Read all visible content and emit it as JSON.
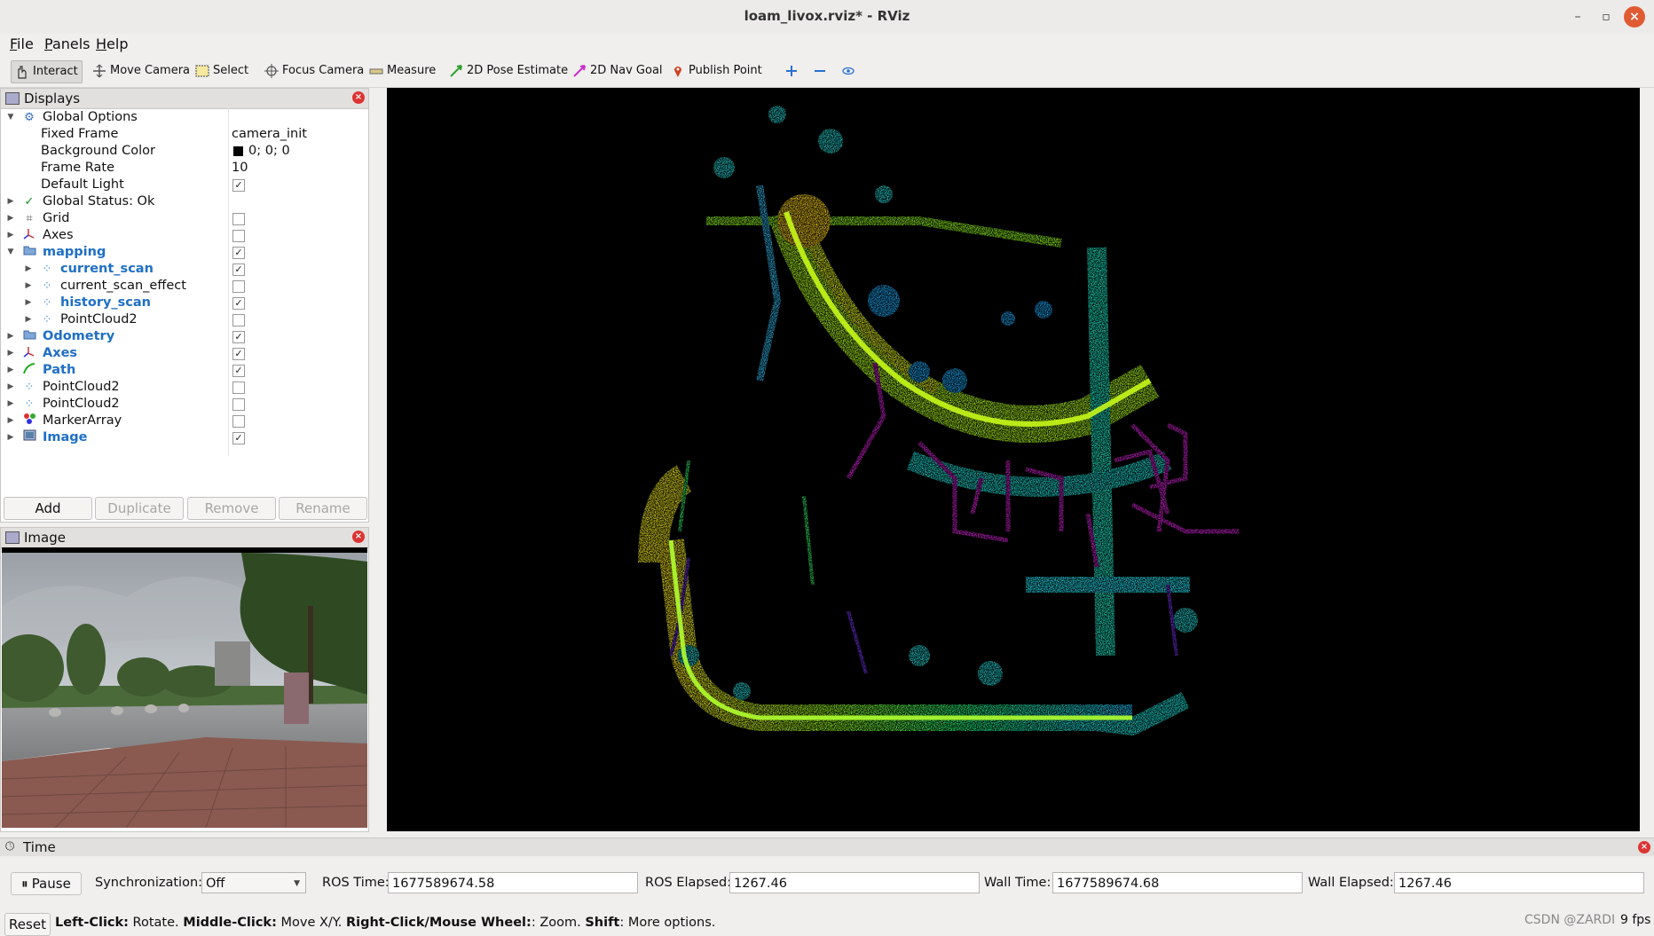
{
  "window": {
    "title": "loam_livox.rviz* - RViz"
  },
  "menu": {
    "file": "File",
    "panels": "Panels",
    "help": "Help"
  },
  "toolbar": {
    "interact": "Interact",
    "move_camera": "Move Camera",
    "select": "Select",
    "focus_camera": "Focus Camera",
    "measure": "Measure",
    "pose_estimate": "2D Pose Estimate",
    "nav_goal": "2D Nav Goal",
    "publish_point": "Publish Point"
  },
  "displays": {
    "title": "Displays",
    "global_options": "Global Options",
    "fixed_frame_label": "Fixed Frame",
    "fixed_frame_value": "camera_init",
    "background_color_label": "Background Color",
    "background_color_value": "0; 0; 0",
    "frame_rate_label": "Frame Rate",
    "frame_rate_value": "10",
    "default_light_label": "Default Light",
    "global_status": "Global Status: Ok",
    "items": [
      {
        "name": "Grid",
        "checked": false
      },
      {
        "name": "Axes",
        "checked": false
      },
      {
        "name": "mapping",
        "checked": true
      },
      {
        "name": "current_scan",
        "checked": true
      },
      {
        "name": "current_scan_effect",
        "checked": false
      },
      {
        "name": "history_scan",
        "checked": true
      },
      {
        "name": "PointCloud2",
        "checked": false
      },
      {
        "name": "Odometry",
        "checked": true
      },
      {
        "name": "Axes",
        "checked": true
      },
      {
        "name": "Path",
        "checked": true
      },
      {
        "name": "PointCloud2",
        "checked": false
      },
      {
        "name": "PointCloud2",
        "checked": false
      },
      {
        "name": "MarkerArray",
        "checked": false
      },
      {
        "name": "Image",
        "checked": true
      }
    ],
    "buttons": {
      "add": "Add",
      "duplicate": "Duplicate",
      "remove": "Remove",
      "rename": "Rename"
    }
  },
  "image_panel": {
    "title": "Image"
  },
  "time_panel": {
    "title": "Time",
    "pause": "Pause",
    "sync_label": "Synchronization:",
    "sync_value": "Off",
    "ros_time_label": "ROS Time:",
    "ros_time_value": "1677589674.58",
    "ros_elapsed_label": "ROS Elapsed:",
    "ros_elapsed_value": "1267.46",
    "wall_time_label": "Wall Time:",
    "wall_time_value": "1677589674.68",
    "wall_elapsed_label": "Wall Elapsed:",
    "wall_elapsed_value": "1267.46"
  },
  "status": {
    "reset": "Reset",
    "left_click_key": "Left-Click:",
    "left_click_desc": " Rotate. ",
    "middle_click_key": "Middle-Click:",
    "middle_click_desc": " Move X/Y. ",
    "right_click_key": "Right-Click/Mouse Wheel:",
    "right_click_desc": ": Zoom. ",
    "shift_key": "Shift",
    "shift_desc": ": More options.",
    "watermark": "CSDN @ZARDI",
    "fps": "9 fps"
  },
  "colors": {
    "accent": "#1f6fc5",
    "close": "#e05a32",
    "background": "#000000"
  }
}
